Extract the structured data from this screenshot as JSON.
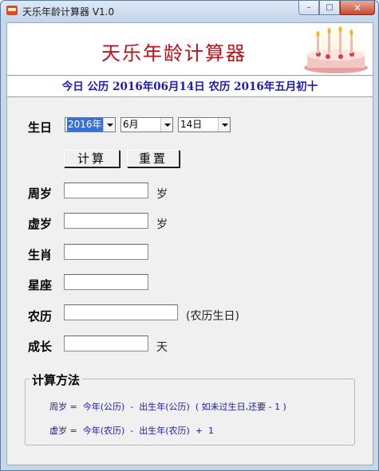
{
  "window": {
    "title": "天乐年龄计算器 V1.0",
    "controls": {
      "minimize": "–",
      "maximize": "□",
      "close": "✕"
    }
  },
  "banner": {
    "app_title": "天乐年龄计算器",
    "date_line": "今日  公历  2016年06月14日  农历  2016年五月初十"
  },
  "birth": {
    "label": "生日",
    "year": "2016年",
    "month": "6月",
    "day": "14日"
  },
  "buttons": {
    "calculate": "计算",
    "reset": "重置"
  },
  "results": {
    "zhousui": {
      "label": "周岁",
      "value": "",
      "unit": "岁"
    },
    "xusui": {
      "label": "虚岁",
      "value": "",
      "unit": "岁"
    },
    "shengxiao": {
      "label": "生肖",
      "value": ""
    },
    "xingzuo": {
      "label": "星座",
      "value": ""
    },
    "nongli": {
      "label": "农历",
      "value": "",
      "unit": "(农历生日)"
    },
    "chengzhang": {
      "label": "成长",
      "value": "",
      "unit": "天"
    }
  },
  "method": {
    "title": "计算方法",
    "line1": "周岁 =  今年(公历)  -  出生年(公历)  ( 如未过生日,还要 - 1 )",
    "line2": "虚岁 =  今年(农历)  -  出生年(农历)  +  1"
  },
  "colors": {
    "title_red": "#c0101a",
    "date_blue": "#1b1bb0",
    "selection": "#3a6fd8",
    "client_bg": "#f0f0f0"
  },
  "icons": {
    "app": "cake-app-icon",
    "banner_image": "birthday-cake-image"
  }
}
